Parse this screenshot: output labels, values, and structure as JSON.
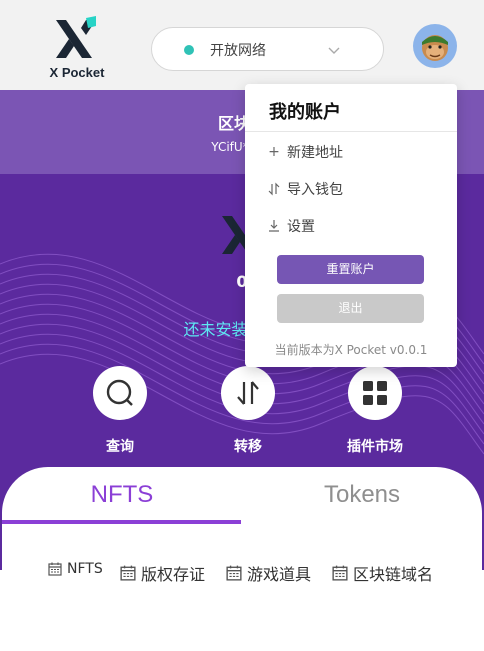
{
  "header": {
    "logo_text": "X Pocket",
    "network_label": "开放网络",
    "network_status_color": "#2fc2b6"
  },
  "account": {
    "title": "区块链",
    "address": "YCifU*****"
  },
  "hero": {
    "balance": "0",
    "notice": "还未安装插件,快"
  },
  "actions": [
    {
      "label": "查询",
      "icon": "search-icon"
    },
    {
      "label": "转移",
      "icon": "transfer-icon"
    },
    {
      "label": "插件市场",
      "icon": "grid-icon"
    }
  ],
  "tabs": [
    {
      "label": "NFTS",
      "active": true
    },
    {
      "label": "Tokens",
      "active": false
    }
  ],
  "filters": [
    {
      "label": "NFTS",
      "icon": "calendar-icon"
    },
    {
      "label": "版权存证",
      "icon": "calendar-icon"
    },
    {
      "label": "游戏道具",
      "icon": "calendar-icon"
    },
    {
      "label": "区块链域名",
      "icon": "calendar-icon"
    }
  ],
  "menu": {
    "title": "我的账户",
    "items": [
      {
        "label": "新建地址",
        "icon": "plus-icon"
      },
      {
        "label": "导入钱包",
        "icon": "import-icon"
      },
      {
        "label": "设置",
        "icon": "download-icon"
      }
    ],
    "reset_label": "重置账户",
    "logout_label": "退出",
    "version": "当前版本为X Pocket v0.0.1"
  },
  "colors": {
    "primary_purple": "#5b2a9e",
    "accent_purple": "#8b3fd6",
    "button_purple": "#7656b4",
    "notice_cyan": "#5ee8f3"
  }
}
